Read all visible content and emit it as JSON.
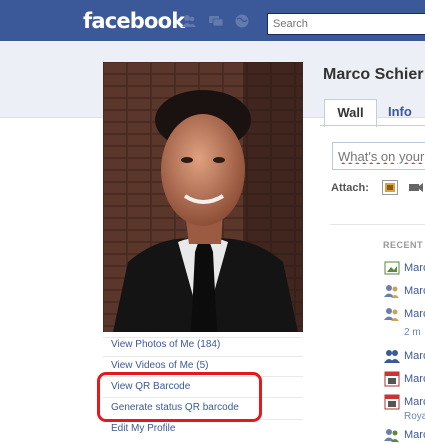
{
  "header": {
    "logo": "facebook",
    "search_placeholder": "Search",
    "brand_color": "#3b5998"
  },
  "profile": {
    "name": "Marco Schier",
    "left_links": [
      "View Photos of Me (184)",
      "View Videos of Me (5)",
      "View QR Barcode",
      "Generate status QR barcode",
      "Edit My Profile"
    ],
    "highlight_color": "#e3191e"
  },
  "tabs": {
    "wall": "Wall",
    "info": "Info"
  },
  "publisher": {
    "placeholder": "What's on your",
    "attach_label": "Attach:"
  },
  "recent": {
    "heading": "RECENT",
    "items": [
      {
        "icon": "photo-icon",
        "text": "Marc"
      },
      {
        "icon": "friends-icon",
        "text": "Marc"
      },
      {
        "icon": "friends-icon",
        "text": "Marc",
        "sub": "2 m"
      },
      {
        "icon": "people-icon",
        "text": "Marc"
      },
      {
        "icon": "calendar-icon",
        "text": "Marc"
      },
      {
        "icon": "calendar-icon",
        "text": "Marc",
        "sub": "Roya"
      },
      {
        "icon": "friends-icon",
        "text": "Marc"
      }
    ]
  }
}
